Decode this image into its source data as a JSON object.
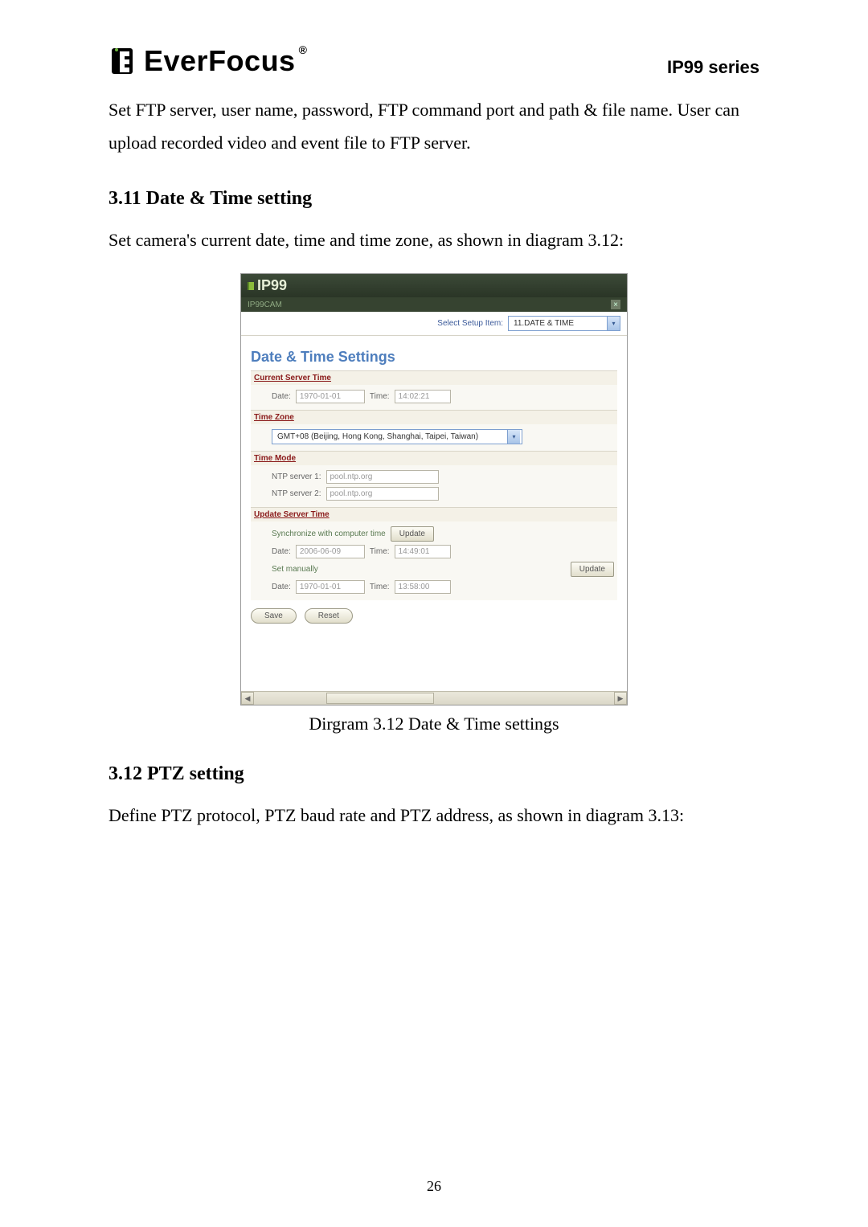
{
  "header": {
    "brand": "EverFocus",
    "registered": "®",
    "series": "IP99 series"
  },
  "para1": "Set FTP server, user name, password, FTP command port and path & file name. User can upload recorded video and event file to FTP server.",
  "sec1": {
    "heading": "3.11 Date & Time setting",
    "para": "Set camera's current date, time and time zone, as shown in diagram 3.12:"
  },
  "fig": {
    "top": "IP99",
    "sub": "IP99CAM",
    "selectLabel": "Select Setup Item:",
    "selectValue": "11.DATE & TIME",
    "title": "Date & Time Settings",
    "sec_current": {
      "head": "Current Server Time",
      "dateLabel": "Date:",
      "dateVal": "1970-01-01",
      "timeLabel": "Time:",
      "timeVal": "14:02:21"
    },
    "sec_tz": {
      "head": "Time Zone",
      "val": "GMT+08 (Beijing, Hong Kong, Shanghai, Taipei, Taiwan)"
    },
    "sec_mode": {
      "head": "Time Mode",
      "ntp1Label": "NTP server 1:",
      "ntp1Val": "pool.ntp.org",
      "ntp2Label": "NTP server 2:",
      "ntp2Val": "pool.ntp.org"
    },
    "sec_update": {
      "head": "Update Server Time",
      "syncLabel": "Synchronize with computer time",
      "btnUpdate1": "Update",
      "dateLabel": "Date:",
      "dateVal": "2006-06-09",
      "timeLabel": "Time:",
      "timeVal": "14:49:01",
      "manualLabel": "Set manually",
      "btnUpdate2": "Update",
      "dateLabel2": "Date:",
      "dateVal2": "1970-01-01",
      "timeLabel2": "Time:",
      "timeVal2": "13:58:00"
    },
    "btnSave": "Save",
    "btnReset": "Reset"
  },
  "caption": "Dirgram 3.12 Date & Time settings",
  "sec2": {
    "heading": "3.12 PTZ setting",
    "para": "Define PTZ protocol, PTZ baud rate and PTZ address, as shown in diagram 3.13:"
  },
  "pageNumber": "26"
}
